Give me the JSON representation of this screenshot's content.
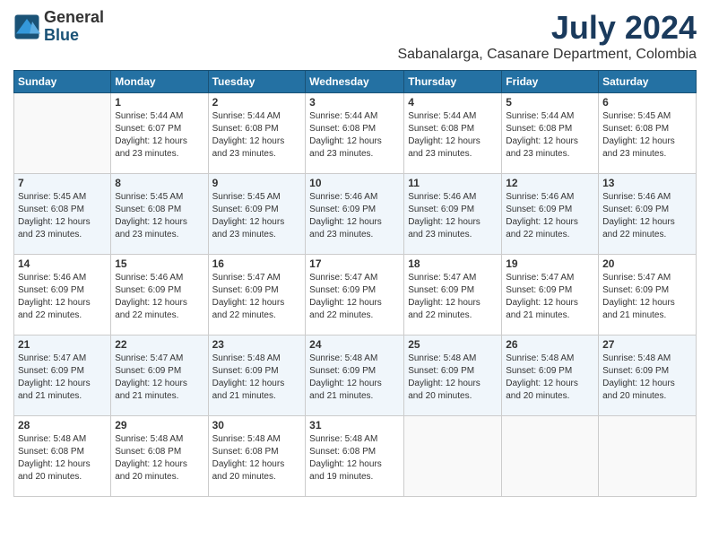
{
  "logo": {
    "general": "General",
    "blue": "Blue"
  },
  "title": "July 2024",
  "subtitle": "Sabanalarga, Casanare Department, Colombia",
  "days": [
    "Sunday",
    "Monday",
    "Tuesday",
    "Wednesday",
    "Thursday",
    "Friday",
    "Saturday"
  ],
  "weeks": [
    [
      {
        "day": "",
        "info": ""
      },
      {
        "day": "1",
        "info": "Sunrise: 5:44 AM\nSunset: 6:07 PM\nDaylight: 12 hours\nand 23 minutes."
      },
      {
        "day": "2",
        "info": "Sunrise: 5:44 AM\nSunset: 6:08 PM\nDaylight: 12 hours\nand 23 minutes."
      },
      {
        "day": "3",
        "info": "Sunrise: 5:44 AM\nSunset: 6:08 PM\nDaylight: 12 hours\nand 23 minutes."
      },
      {
        "day": "4",
        "info": "Sunrise: 5:44 AM\nSunset: 6:08 PM\nDaylight: 12 hours\nand 23 minutes."
      },
      {
        "day": "5",
        "info": "Sunrise: 5:44 AM\nSunset: 6:08 PM\nDaylight: 12 hours\nand 23 minutes."
      },
      {
        "day": "6",
        "info": "Sunrise: 5:45 AM\nSunset: 6:08 PM\nDaylight: 12 hours\nand 23 minutes."
      }
    ],
    [
      {
        "day": "7",
        "info": "Sunrise: 5:45 AM\nSunset: 6:08 PM\nDaylight: 12 hours\nand 23 minutes."
      },
      {
        "day": "8",
        "info": "Sunrise: 5:45 AM\nSunset: 6:08 PM\nDaylight: 12 hours\nand 23 minutes."
      },
      {
        "day": "9",
        "info": "Sunrise: 5:45 AM\nSunset: 6:09 PM\nDaylight: 12 hours\nand 23 minutes."
      },
      {
        "day": "10",
        "info": "Sunrise: 5:46 AM\nSunset: 6:09 PM\nDaylight: 12 hours\nand 23 minutes."
      },
      {
        "day": "11",
        "info": "Sunrise: 5:46 AM\nSunset: 6:09 PM\nDaylight: 12 hours\nand 23 minutes."
      },
      {
        "day": "12",
        "info": "Sunrise: 5:46 AM\nSunset: 6:09 PM\nDaylight: 12 hours\nand 22 minutes."
      },
      {
        "day": "13",
        "info": "Sunrise: 5:46 AM\nSunset: 6:09 PM\nDaylight: 12 hours\nand 22 minutes."
      }
    ],
    [
      {
        "day": "14",
        "info": "Sunrise: 5:46 AM\nSunset: 6:09 PM\nDaylight: 12 hours\nand 22 minutes."
      },
      {
        "day": "15",
        "info": "Sunrise: 5:46 AM\nSunset: 6:09 PM\nDaylight: 12 hours\nand 22 minutes."
      },
      {
        "day": "16",
        "info": "Sunrise: 5:47 AM\nSunset: 6:09 PM\nDaylight: 12 hours\nand 22 minutes."
      },
      {
        "day": "17",
        "info": "Sunrise: 5:47 AM\nSunset: 6:09 PM\nDaylight: 12 hours\nand 22 minutes."
      },
      {
        "day": "18",
        "info": "Sunrise: 5:47 AM\nSunset: 6:09 PM\nDaylight: 12 hours\nand 22 minutes."
      },
      {
        "day": "19",
        "info": "Sunrise: 5:47 AM\nSunset: 6:09 PM\nDaylight: 12 hours\nand 21 minutes."
      },
      {
        "day": "20",
        "info": "Sunrise: 5:47 AM\nSunset: 6:09 PM\nDaylight: 12 hours\nand 21 minutes."
      }
    ],
    [
      {
        "day": "21",
        "info": "Sunrise: 5:47 AM\nSunset: 6:09 PM\nDaylight: 12 hours\nand 21 minutes."
      },
      {
        "day": "22",
        "info": "Sunrise: 5:47 AM\nSunset: 6:09 PM\nDaylight: 12 hours\nand 21 minutes."
      },
      {
        "day": "23",
        "info": "Sunrise: 5:48 AM\nSunset: 6:09 PM\nDaylight: 12 hours\nand 21 minutes."
      },
      {
        "day": "24",
        "info": "Sunrise: 5:48 AM\nSunset: 6:09 PM\nDaylight: 12 hours\nand 21 minutes."
      },
      {
        "day": "25",
        "info": "Sunrise: 5:48 AM\nSunset: 6:09 PM\nDaylight: 12 hours\nand 20 minutes."
      },
      {
        "day": "26",
        "info": "Sunrise: 5:48 AM\nSunset: 6:09 PM\nDaylight: 12 hours\nand 20 minutes."
      },
      {
        "day": "27",
        "info": "Sunrise: 5:48 AM\nSunset: 6:09 PM\nDaylight: 12 hours\nand 20 minutes."
      }
    ],
    [
      {
        "day": "28",
        "info": "Sunrise: 5:48 AM\nSunset: 6:08 PM\nDaylight: 12 hours\nand 20 minutes."
      },
      {
        "day": "29",
        "info": "Sunrise: 5:48 AM\nSunset: 6:08 PM\nDaylight: 12 hours\nand 20 minutes."
      },
      {
        "day": "30",
        "info": "Sunrise: 5:48 AM\nSunset: 6:08 PM\nDaylight: 12 hours\nand 20 minutes."
      },
      {
        "day": "31",
        "info": "Sunrise: 5:48 AM\nSunset: 6:08 PM\nDaylight: 12 hours\nand 19 minutes."
      },
      {
        "day": "",
        "info": ""
      },
      {
        "day": "",
        "info": ""
      },
      {
        "day": "",
        "info": ""
      }
    ]
  ]
}
